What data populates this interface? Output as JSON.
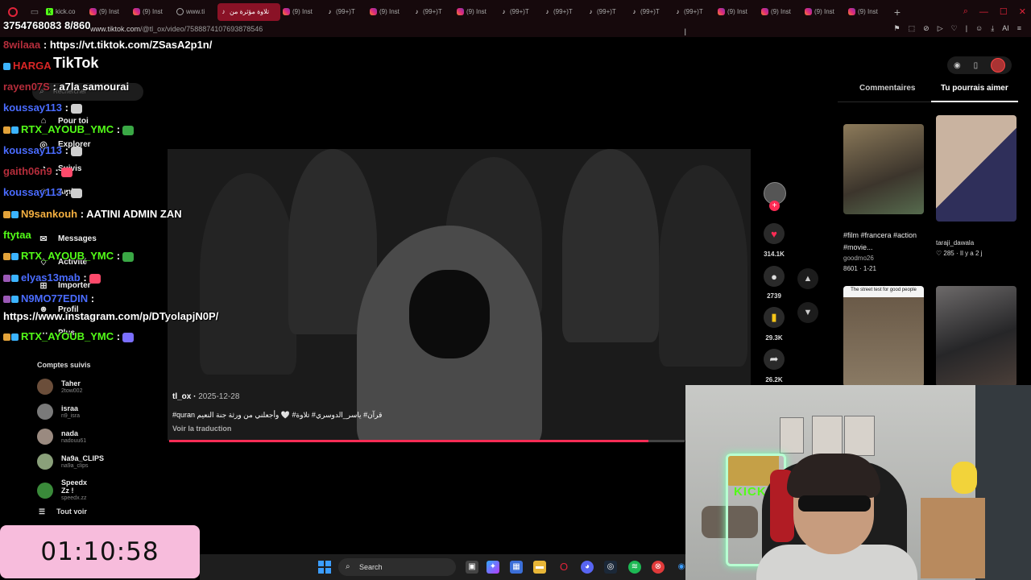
{
  "browser": {
    "tabs": [
      {
        "label": "kick.co",
        "fav": "kick"
      },
      {
        "label": "(9) Inst",
        "fav": "ig"
      },
      {
        "label": "(9) Inst",
        "fav": "ig"
      },
      {
        "label": "www.ti",
        "fav": "www"
      },
      {
        "label": "تلاوة مؤثرة من",
        "fav": "tt",
        "active": true
      },
      {
        "label": "(9) Inst",
        "fav": "ig"
      },
      {
        "label": "(99+)T",
        "fav": "tt"
      },
      {
        "label": "(9) Inst",
        "fav": "ig"
      },
      {
        "label": "(99+)T",
        "fav": "tt"
      },
      {
        "label": "(9) Inst",
        "fav": "ig"
      },
      {
        "label": "(99+)T",
        "fav": "tt"
      },
      {
        "label": "(99+)T",
        "fav": "tt"
      },
      {
        "label": "(99+)T",
        "fav": "tt"
      },
      {
        "label": "(99+)T",
        "fav": "tt"
      },
      {
        "label": "(99+)T",
        "fav": "tt"
      },
      {
        "label": "(9) Inst",
        "fav": "ig"
      },
      {
        "label": "(9) Inst",
        "fav": "ig"
      },
      {
        "label": "(9) Inst",
        "fav": "ig"
      },
      {
        "label": "(9) Inst",
        "fav": "ig"
      }
    ],
    "new_tab": "+",
    "url_host": "www.tiktok.com",
    "url_path": "/@tl_ox/video/7588874107693878546",
    "ai_label": "AI"
  },
  "tiktok": {
    "logo": "TikTok",
    "search_placeholder": "Rechercher",
    "nav": [
      {
        "label": "Pour toi",
        "icon": "home-icon",
        "glyph": "⌂"
      },
      {
        "label": "Explorer",
        "icon": "compass-icon",
        "glyph": "◎"
      },
      {
        "label": "Suivis",
        "icon": "following-icon",
        "glyph": "◔"
      },
      {
        "label": "Amis",
        "icon": "friends-icon",
        "glyph": "☺"
      },
      {
        "label": "Messages",
        "icon": "messages-icon",
        "glyph": "✉"
      },
      {
        "label": "Activité",
        "icon": "activity-icon",
        "glyph": "♢"
      },
      {
        "label": "Importer",
        "icon": "upload-icon",
        "glyph": "⊞"
      },
      {
        "label": "Profil",
        "icon": "profile-icon",
        "glyph": "☻"
      },
      {
        "label": "Plus",
        "icon": "more-icon",
        "glyph": "⋯"
      }
    ],
    "following_title": "Comptes suivis",
    "following": [
      {
        "name": "Taher",
        "handle": "2tow002"
      },
      {
        "name": "israa",
        "handle": "n9_isra"
      },
      {
        "name": "nada",
        "handle": "nadouu61"
      },
      {
        "name": "Na9a_CLIPS",
        "handle": "na9a_clips"
      },
      {
        "name": "Speedx Zz !",
        "handle": "speedx.zz"
      }
    ],
    "see_all": "Tout voir"
  },
  "chat": [
    {
      "user": "3754768083",
      "userColor": "#ffffff",
      "msg": "8/860",
      "badges": []
    },
    {
      "user": "8wilaaa",
      "userColor": "#b52d3b",
      "msg": ": https://vt.tiktok.com/ZSasA2p1n/",
      "badges": []
    },
    {
      "user": "HARGA",
      "userColor": "#d92626",
      "msg": "",
      "badges": [
        "#3cb4ff"
      ]
    },
    {
      "user": "rayen07S",
      "userColor": "#b52d3b",
      "msg": ": a7la samourai",
      "badges": []
    },
    {
      "user": "koussay113",
      "userColor": "#4a6cff",
      "msg": ":",
      "badges": [],
      "emote": "#cfcfcf"
    },
    {
      "user": "RTX_AYOUB_YMC",
      "userColor": "#53fc18",
      "msg": ":",
      "badges": [
        "#e3a33a",
        "#3cb4ff"
      ],
      "emote": "#3aa845"
    },
    {
      "user": "koussay113",
      "userColor": "#4a6cff",
      "msg": ":",
      "badges": [],
      "emote": "#cfcfcf"
    },
    {
      "user": "gaith06n9",
      "userColor": "#b52d3b",
      "msg": ":",
      "badges": [],
      "emote": "#ff4a6b"
    },
    {
      "user": "koussay113",
      "userColor": "#4a6cff",
      "msg": ":",
      "badges": [],
      "emote": "#cfcfcf"
    },
    {
      "user": "N9sankouh",
      "userColor": "#f5b041",
      "msg": ": AATINI ADMIN ZAN",
      "badges": [
        "#e3a33a",
        "#3cb4ff"
      ]
    },
    {
      "user": "ftytaa",
      "userColor": "#53fc18",
      "msg": "",
      "badges": []
    },
    {
      "user": "RTX_AYOUB_YMC",
      "userColor": "#53fc18",
      "msg": ":",
      "badges": [
        "#e3a33a",
        "#3cb4ff"
      ],
      "emote": "#3aa845"
    },
    {
      "user": "elyas13mab",
      "userColor": "#4a6cff",
      "msg": ":",
      "badges": [
        "#9b59b6",
        "#3cb4ff"
      ],
      "emote": "#ff4a6b"
    },
    {
      "user": "N9MO77EDIN",
      "userColor": "#4a6cff",
      "msg": ":",
      "badges": [
        "#9b59b6",
        "#3cb4ff"
      ]
    },
    {
      "user": "https://www.instagram.com/p/DTyolapjN0P/",
      "userColor": "#ffffff",
      "msg": "",
      "badges": []
    },
    {
      "user": "RTX_AYOUB_YMC",
      "userColor": "#53fc18",
      "msg": ":",
      "badges": [
        "#e3a33a",
        "#3cb4ff"
      ],
      "emote": "#7b6fff"
    }
  ],
  "video": {
    "author": "tl_ox",
    "date": "2025-12-28",
    "caption": "#quran قرآن# ياسر_الدوسري# تلاوة# 🤍 وأجعلني من ورثة جنة النعيم",
    "translate": "Voir la traduction",
    "progress": 0.93
  },
  "actions": {
    "likes": "314.1K",
    "comments": "2739",
    "saves": "29.3K",
    "shares": "26.2K"
  },
  "right_panel": {
    "tab_comments": "Commentaires",
    "tab_suggested": "Tu pourrais aimer",
    "recs": [
      {
        "title": "#film #francera #action #movie...",
        "author": "goodmo26",
        "stats": "8601 · 1-21"
      },
      {
        "title": "",
        "author": "taraji_dawala",
        "stats": "285 · Il y a 2 j"
      },
      {
        "title": "The street test for good people",
        "author": "",
        "stats": ""
      },
      {
        "title": "",
        "author": "",
        "stats": ""
      }
    ]
  },
  "overlay": {
    "timer": "01:10:58",
    "cam_sign": "KICK"
  },
  "taskbar": {
    "search_label": "Search"
  }
}
